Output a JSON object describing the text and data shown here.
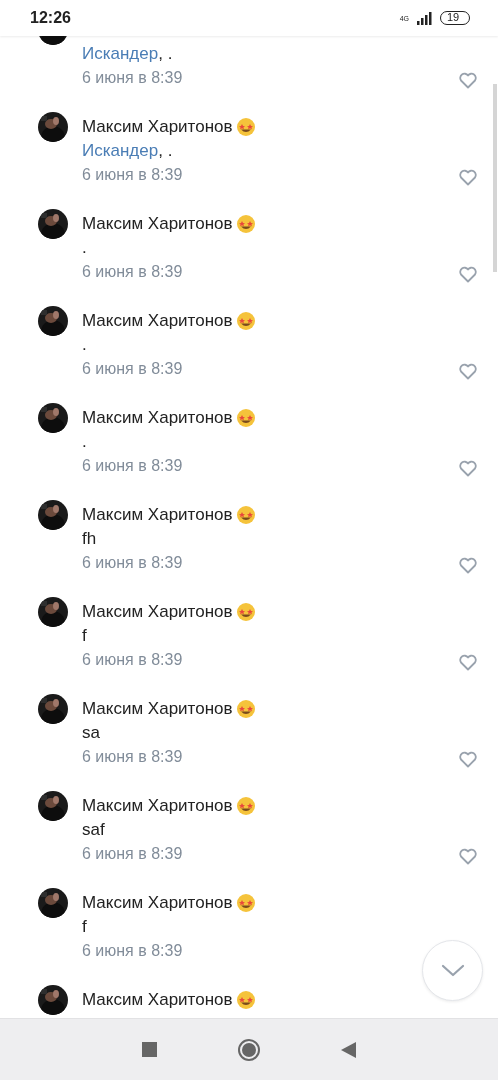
{
  "status_bar": {
    "time": "12:26",
    "network": "4G",
    "battery": "19"
  },
  "comments": [
    {
      "reply_to": "Искандер",
      "text": ", .",
      "time": "6 июня в 8:39",
      "liked": false
    },
    {
      "author": "Максим Харитонов",
      "reply_to": "Искандер",
      "text": ", .",
      "time": "6 июня в 8:39",
      "liked": false
    },
    {
      "author": "Максим Харитонов",
      "text": ".",
      "time": "6 июня в 8:39",
      "liked": false
    },
    {
      "author": "Максим Харитонов",
      "text": ".",
      "time": "6 июня в 8:39",
      "liked": false
    },
    {
      "author": "Максим Харитонов",
      "text": ".",
      "time": "6 июня в 8:39",
      "liked": false
    },
    {
      "author": "Максим Харитонов",
      "text": "fh",
      "time": "6 июня в 8:39",
      "liked": false
    },
    {
      "author": "Максим Харитонов",
      "text": "f",
      "time": "6 июня в 8:39",
      "liked": false
    },
    {
      "author": "Максим Харитонов",
      "text": "sa",
      "time": "6 июня в 8:39",
      "liked": false
    },
    {
      "author": "Максим Харитонов",
      "text": "saf",
      "time": "6 июня в 8:39",
      "liked": false
    },
    {
      "author": "Максим Харитонов",
      "text": "f",
      "time": "6 июня в 8:39"
    },
    {
      "author": "Максим Харитонов"
    }
  ]
}
